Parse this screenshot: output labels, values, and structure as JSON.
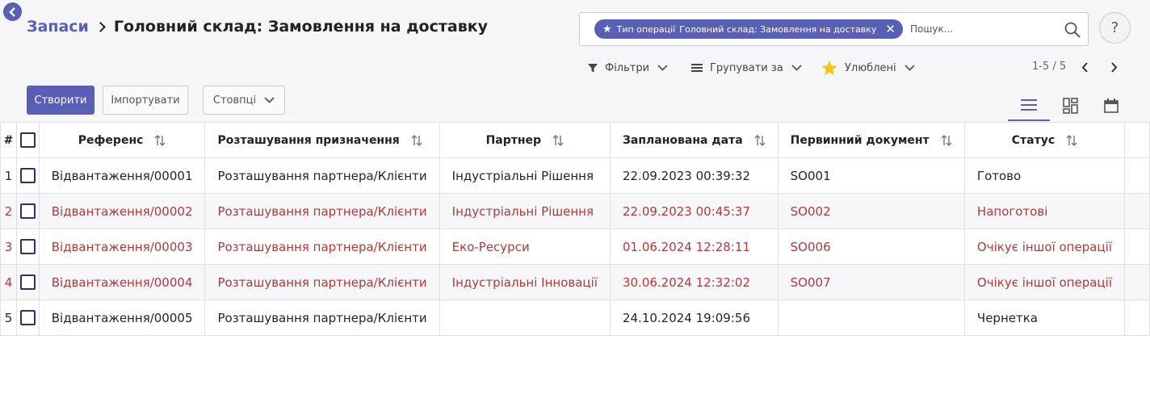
{
  "breadcrumb": {
    "parent": "Запаси",
    "current": "Головний склад: Замовлення на доставку"
  },
  "search": {
    "facet_label": "Тип операції",
    "facet_value": "Головний склад: Замовлення на доставку",
    "placeholder": "Пошук..."
  },
  "filters": {
    "filter_label": "Фільтри",
    "group_label": "Групувати за",
    "favorites_label": "Улюблені"
  },
  "pager": {
    "text": "1-5 / 5"
  },
  "buttons": {
    "create": "Створити",
    "import": "Імпортувати",
    "columns": "Стовпці"
  },
  "table": {
    "columns": [
      "#",
      "Референс",
      "Розташування призначення",
      "Партнер",
      "Запланована дата",
      "Первинний документ",
      "Статус"
    ],
    "rows": [
      {
        "n": "1",
        "ref": "Відвантаження/00001",
        "dest": "Розташування партнера/Клієнти",
        "partner": "Індустріальні Рішення",
        "date": "22.09.2023 00:39:32",
        "doc": "SO001",
        "status": "Готово"
      },
      {
        "n": "2",
        "ref": "Відвантаження/00002",
        "dest": "Розташування партнера/Клієнти",
        "partner": "Індустріальні Рішення",
        "date": "22.09.2023 00:45:37",
        "doc": "SO002",
        "status": "Напоготові"
      },
      {
        "n": "3",
        "ref": "Відвантаження/00003",
        "dest": "Розташування партнера/Клієнти",
        "partner": "Еко-Ресурси",
        "date": "01.06.2024 12:28:11",
        "doc": "SO006",
        "status": "Очікує іншої операції"
      },
      {
        "n": "4",
        "ref": "Відвантаження/00004",
        "dest": "Розташування партнера/Клієнти",
        "partner": "Індустріальні Інновації",
        "date": "30.06.2024 12:32:02",
        "doc": "SO007",
        "status": "Очікує іншої операції"
      },
      {
        "n": "5",
        "ref": "Відвантаження/00005",
        "dest": "Розташування партнера/Клієнти",
        "partner": "",
        "date": "24.10.2024 19:09:56",
        "doc": "",
        "status": "Чернетка"
      }
    ]
  },
  "colors": {
    "accent": "#5a5fb6",
    "late_text": "#b03a3a",
    "favorite_star": "#f3c614"
  },
  "icons": [
    "back-arrow-icon",
    "star-icon",
    "close-icon",
    "search-icon",
    "filter-icon",
    "group-by-icon",
    "favorite-star-icon",
    "chevron-down-icon",
    "chevron-left-icon",
    "chevron-right-icon",
    "list-view-icon",
    "kanban-view-icon",
    "calendar-view-icon",
    "sort-icon"
  ]
}
